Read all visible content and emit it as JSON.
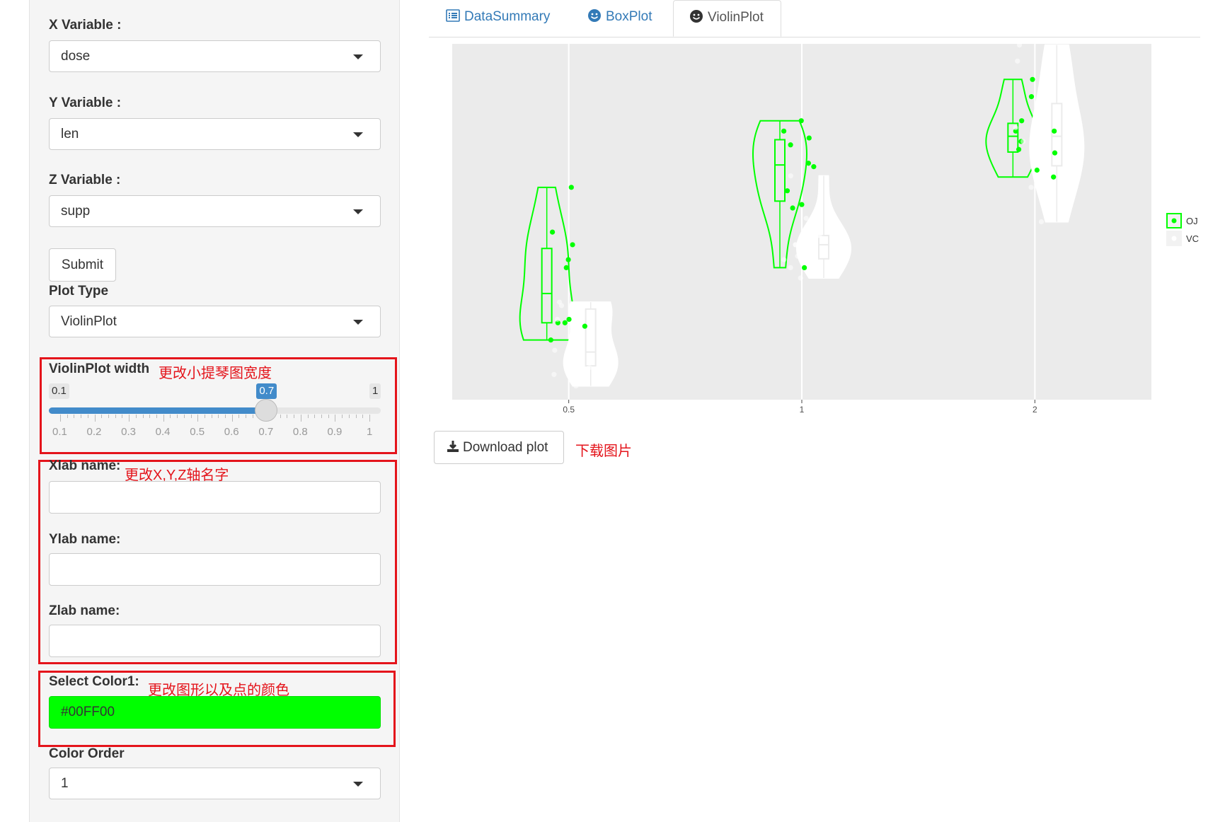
{
  "sidebar": {
    "x_variable": {
      "label": "X Variable :",
      "value": "dose"
    },
    "y_variable": {
      "label": "Y Variable :",
      "value": "len"
    },
    "z_variable": {
      "label": "Z Variable :",
      "value": "supp"
    },
    "submit_label": "Submit",
    "plot_type": {
      "label": "Plot Type",
      "value": "ViolinPlot"
    },
    "violin_width": {
      "label": "ViolinPlot width",
      "min": "0.1",
      "max": "1",
      "value": "0.7",
      "fraction": 0.6667,
      "ticks": [
        "0.1",
        "0.2",
        "0.3",
        "0.4",
        "0.5",
        "0.6",
        "0.7",
        "0.8",
        "0.9",
        "1"
      ]
    },
    "xlab": {
      "label": "Xlab name:",
      "value": ""
    },
    "ylab": {
      "label": "Ylab name:",
      "value": ""
    },
    "zlab": {
      "label": "Zlab name:",
      "value": ""
    },
    "color1": {
      "label": "Select Color1:",
      "value": "#00FF00",
      "color": "#00FF00"
    },
    "color_order": {
      "label": "Color Order",
      "value": "1"
    }
  },
  "tabs": [
    {
      "label": "DataSummary",
      "icon": "list-icon"
    },
    {
      "label": "BoxPlot",
      "icon": "smile-icon"
    },
    {
      "label": "ViolinPlot",
      "icon": "smile-icon",
      "active": true
    }
  ],
  "download_label": "Download plot",
  "annotations": {
    "width_note": "更改小提琴图宽度",
    "axis_note": "更改X,Y,Z轴名字",
    "color_note": "更改图形以及点的颜色",
    "download_note": "下载图片"
  },
  "chart_data": {
    "type": "violin",
    "categories": [
      "0.5",
      "1",
      "2"
    ],
    "legend": [
      "OJ",
      "VC"
    ],
    "legend_position": "right",
    "colors": {
      "OJ": "#00FF00",
      "VC": "#FFFFFF",
      "panel": "#EBEBEB"
    },
    "ylim": [
      3,
      34
    ],
    "series": [
      {
        "name": "OJ",
        "values": [
          [
            15.2,
            21.5,
            17.6,
            9.7,
            14.5,
            10.0,
            8.2,
            9.4,
            16.5,
            9.7
          ],
          [
            19.7,
            23.3,
            23.6,
            26.4,
            20.0,
            25.2,
            25.8,
            21.2,
            14.5,
            27.3
          ],
          [
            25.5,
            26.4,
            22.4,
            24.5,
            24.8,
            30.9,
            26.4,
            27.3,
            29.4,
            23.0
          ]
        ]
      },
      {
        "name": "VC",
        "values": [
          [
            4.2,
            11.5,
            7.3,
            5.8,
            6.4,
            10.0,
            11.2,
            11.2,
            5.2,
            7.0
          ],
          [
            16.5,
            16.5,
            15.2,
            17.3,
            22.5,
            17.3,
            13.6,
            14.5,
            18.8,
            15.5
          ],
          [
            23.6,
            18.5,
            33.9,
            25.5,
            26.4,
            32.5,
            26.7,
            21.5,
            23.3,
            29.5
          ]
        ]
      }
    ]
  }
}
